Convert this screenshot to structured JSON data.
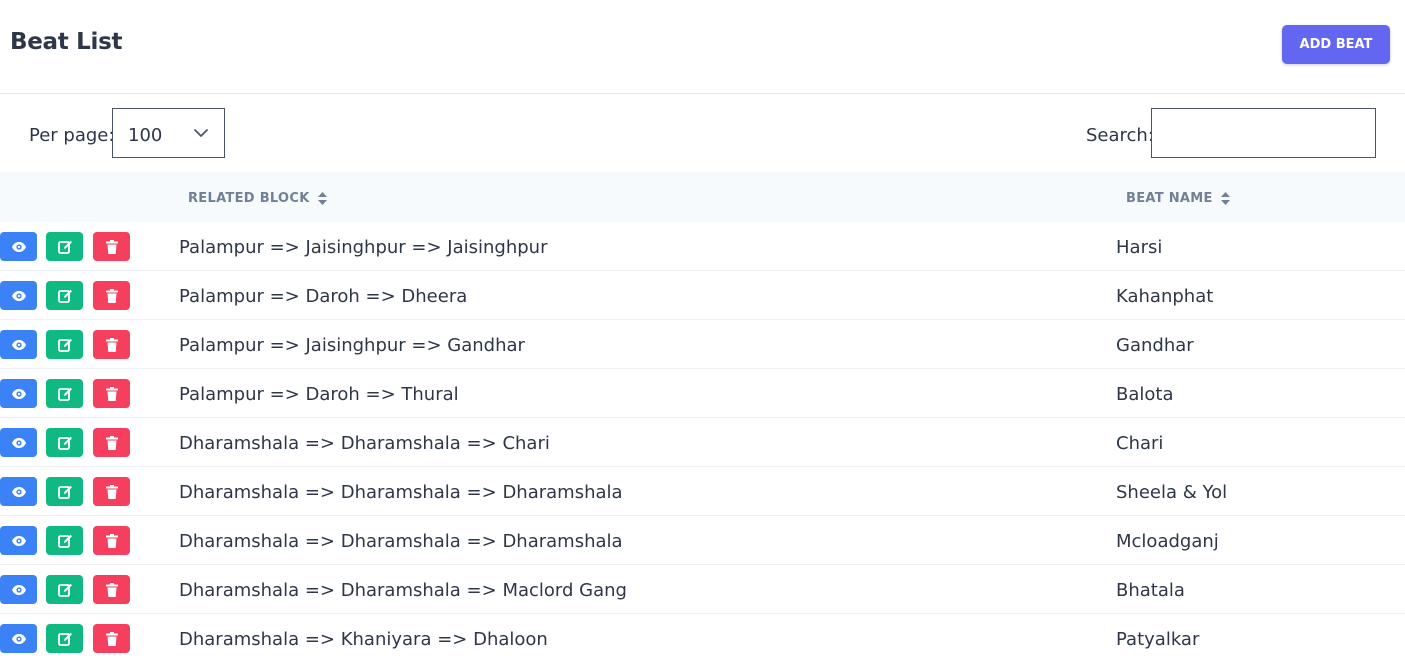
{
  "header": {
    "title": "Beat List",
    "add_button": "ADD BEAT"
  },
  "controls": {
    "per_page_label": "Per page:",
    "per_page_value": "100",
    "search_label": "Search:",
    "search_value": ""
  },
  "table": {
    "columns": [
      "RELATED BLOCK",
      "BEAT NAME"
    ],
    "rows": [
      {
        "block": "Palampur => Jaisinghpur => Jaisinghpur",
        "beat": "Harsi"
      },
      {
        "block": "Palampur => Daroh => Dheera",
        "beat": "Kahanphat"
      },
      {
        "block": "Palampur => Jaisinghpur => Gandhar",
        "beat": "Gandhar"
      },
      {
        "block": "Palampur => Daroh => Thural",
        "beat": "Balota"
      },
      {
        "block": "Dharamshala => Dharamshala => Chari",
        "beat": "Chari"
      },
      {
        "block": "Dharamshala => Dharamshala => Dharamshala",
        "beat": "Sheela & Yol"
      },
      {
        "block": "Dharamshala => Dharamshala => Dharamshala",
        "beat": "Mcloadganj"
      },
      {
        "block": "Dharamshala => Dharamshala => Maclord Gang",
        "beat": "Bhatala"
      },
      {
        "block": "Dharamshala => Khaniyara => Dhaloon",
        "beat": "Patyalkar"
      }
    ]
  },
  "colors": {
    "accent": "#6366f1",
    "view": "#3b82f6",
    "edit": "#10b981",
    "delete": "#f43f5e"
  },
  "icons": {
    "view": "eye-icon",
    "edit": "edit-icon",
    "delete": "trash-icon",
    "sort": "sort-icon",
    "dropdown": "chevron-down-icon"
  }
}
